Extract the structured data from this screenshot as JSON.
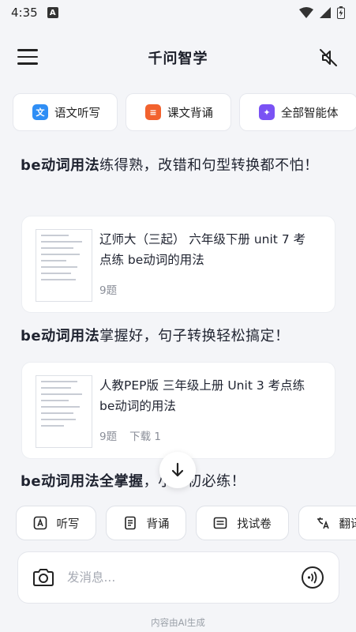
{
  "status": {
    "time": "4:35",
    "app_icon_letter": "A"
  },
  "header": {
    "title": "千问智学"
  },
  "agents": [
    {
      "label": "语文听写",
      "icon_glyph": "文",
      "icon_color": "#2f8ef5"
    },
    {
      "label": "课文背诵",
      "icon_glyph": "≡",
      "icon_color": "#f2622e"
    },
    {
      "label": "全部智能体",
      "icon_glyph": "✦",
      "icon_color": "#7a52f4"
    }
  ],
  "messages": [
    {
      "bold": "be动词用法",
      "rest": "练得熟，改错和句型转换都不怕！"
    },
    {
      "bold": "be动词用法",
      "rest": "掌握好，句子转换轻松搞定！"
    },
    {
      "bold": "be动词用法全掌握",
      "rest": "，小升初必练！"
    }
  ],
  "cards": [
    {
      "title": "辽师大（三起） 六年级下册 unit 7 考点练 be动词的用法",
      "count": "9题",
      "downloads": ""
    },
    {
      "title": "人教PEP版 三年级上册 Unit 3 考点练 be动词的用法",
      "count": "9题",
      "downloads": "下载 1"
    }
  ],
  "quick_actions": [
    {
      "label": "听写",
      "icon": "dictation-icon"
    },
    {
      "label": "背诵",
      "icon": "recite-icon"
    },
    {
      "label": "找试卷",
      "icon": "exam-paper-icon"
    },
    {
      "label": "翻译",
      "icon": "translate-icon"
    }
  ],
  "composer": {
    "placeholder": "发消息..."
  },
  "footer": {
    "note": "内容由AI生成"
  },
  "colors": {
    "background": "#f4f5f8",
    "card": "#ffffff",
    "text": "#1f2330",
    "muted": "#8a8e98"
  }
}
